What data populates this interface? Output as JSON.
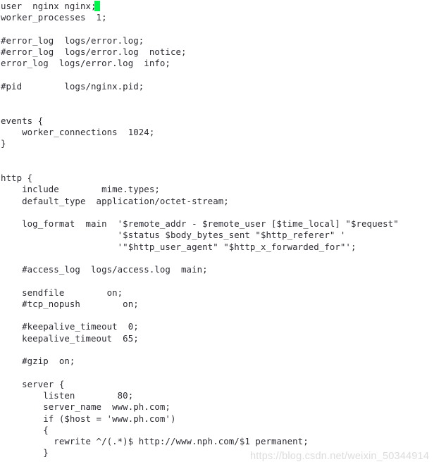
{
  "document": {
    "type": "nginx-configuration-file",
    "font_size_px": 12.4,
    "text_color": "#2c2c34",
    "background_color": "#ffffff",
    "lines": [
      "user  nginx nginx;",
      "worker_processes  1;",
      "",
      "#error_log  logs/error.log;",
      "#error_log  logs/error.log  notice;",
      "error_log  logs/error.log  info;",
      "",
      "#pid        logs/nginx.pid;",
      "",
      "",
      "events {",
      "    worker_connections  1024;",
      "}",
      "",
      "",
      "http {",
      "    include        mime.types;",
      "    default_type  application/octet-stream;",
      "",
      "    log_format  main  '$remote_addr - $remote_user [$time_local] \"$request\"",
      "                      '$status $body_bytes_sent \"$http_referer\" '",
      "                      '\"$http_user_agent\" \"$http_x_forwarded_for\"';",
      "",
      "    #access_log  logs/access.log  main;",
      "",
      "    sendfile        on;",
      "    #tcp_nopush        on;",
      "",
      "    #keepalive_timeout  0;",
      "    keepalive_timeout  65;",
      "",
      "    #gzip  on;",
      "",
      "    server {",
      "        listen        80;",
      "        server_name  www.ph.com;",
      "        if ($host = 'www.ph.com')",
      "        {",
      "          rewrite ^/(.*)$ http://www.nph.com/$1 permanent;",
      "        }"
    ]
  },
  "cursor": {
    "color": "#00f54a",
    "line_index": 0,
    "column": 18
  },
  "watermark": {
    "text": "https://blog.csdn.net/weixin_50344914",
    "color": "#dcdcdc"
  }
}
